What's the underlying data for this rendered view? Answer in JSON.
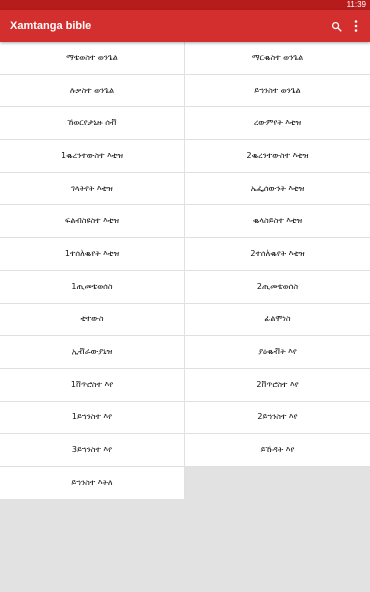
{
  "status_bar": {
    "time": "11:39"
  },
  "app_bar": {
    "title": "Xamtanga bible",
    "actions": [
      "search-icon",
      "more-vert-icon"
    ]
  },
  "books": [
    "ማቴወስተ ወንጌል",
    "ማርቈስተ ወንጌል",
    "ሉቃስተ ወንጌል",
    "ይኀንስተ ወንጌል",
    "ኸወርየታኒዙ ሰቭ",
    "ረውምየት እቲዝ",
    "1ቈረንተውስተ እቲዝ",
    "2ቈረንተውስተ እቲዝ",
    "ገላትየት እቲዝ",
    "ኤፌሰውንት እቲዝ",
    "ፍልብስዩስተ እቲዝ",
    "ቈላስይስተ እቲዝ",
    "1ተሰለ፞ቈየት እቲዝ",
    "2ተሰለ፞ቈየት እቲዝ",
    "1ጢመቴወሰስ",
    "2ጢመቴወሰስ",
    "ቲተውስ",
    "ፊልሞነስ",
    "ኢቭራውያኒዝ",
    "ያዕቈቭት እየ",
    "1ቨጥሮስተ እየ",
    "2ቨጥሮስተ እየ",
    "1ይኀንስተ እየ",
    "2ይኀንስተ እየ",
    "3ይኀንስተ እየ",
    "ይኹዳት እየ",
    "ይኀንስተ እትለ"
  ],
  "colors": {
    "status_bar": "#b71c1c",
    "app_bar": "#d32f2f",
    "background": "#e2e2e2",
    "cell": "#ffffff",
    "divider": "#e0e0e0"
  }
}
